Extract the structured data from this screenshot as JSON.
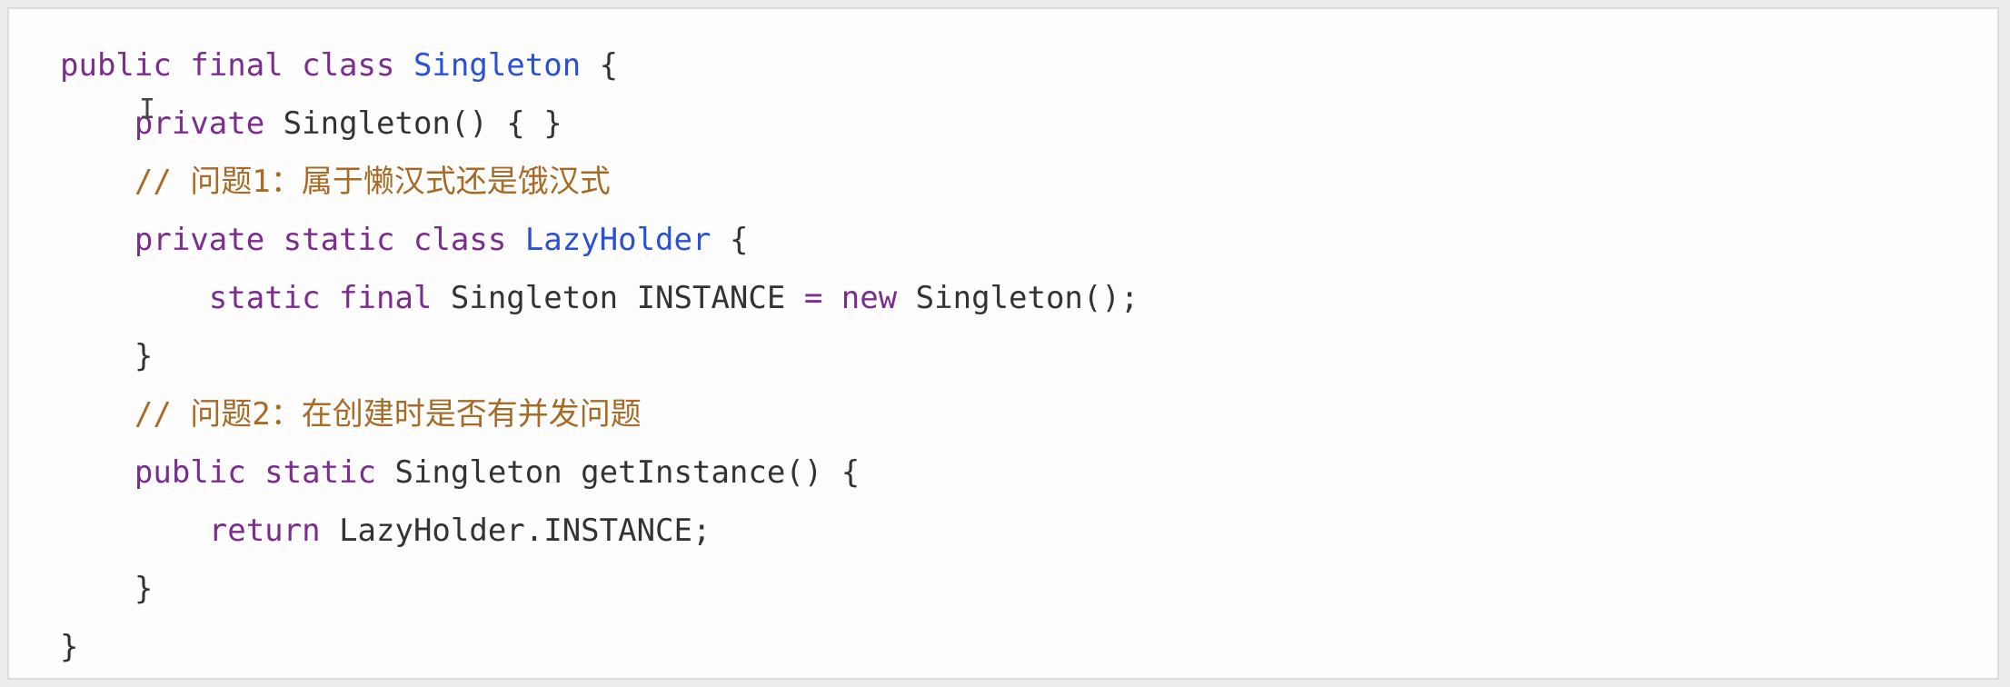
{
  "lines": [
    [
      {
        "t": "public final class ",
        "k": "kw"
      },
      {
        "t": "Singleton",
        "k": "cls"
      },
      {
        "t": " {",
        "k": "txt"
      }
    ],
    [
      {
        "t": "    ",
        "k": "txt"
      },
      {
        "t": "private",
        "k": "kw"
      },
      {
        "t": " Singleton() { }",
        "k": "txt"
      }
    ],
    [
      {
        "t": "    // 问题1：属于懒汉式还是饿汉式",
        "k": "cmt"
      }
    ],
    [
      {
        "t": "    ",
        "k": "txt"
      },
      {
        "t": "private static class ",
        "k": "kw"
      },
      {
        "t": "LazyHolder",
        "k": "cls"
      },
      {
        "t": " {",
        "k": "txt"
      }
    ],
    [
      {
        "t": "        ",
        "k": "txt"
      },
      {
        "t": "static final",
        "k": "kw"
      },
      {
        "t": " Singleton INSTANCE ",
        "k": "txt"
      },
      {
        "t": "=",
        "k": "kw"
      },
      {
        "t": " ",
        "k": "txt"
      },
      {
        "t": "new",
        "k": "kw"
      },
      {
        "t": " Singleton();",
        "k": "txt"
      }
    ],
    [
      {
        "t": "    }",
        "k": "txt"
      }
    ],
    [
      {
        "t": "    // 问题2：在创建时是否有并发问题",
        "k": "cmt"
      }
    ],
    [
      {
        "t": "    ",
        "k": "txt"
      },
      {
        "t": "public static",
        "k": "kw"
      },
      {
        "t": " Singleton getInstance() {",
        "k": "txt"
      }
    ],
    [
      {
        "t": "        ",
        "k": "txt"
      },
      {
        "t": "return",
        "k": "kw"
      },
      {
        "t": " LazyHolder.INSTANCE;",
        "k": "txt"
      }
    ],
    [
      {
        "t": "    }",
        "k": "txt"
      }
    ],
    [
      {
        "t": "}",
        "k": "txt"
      }
    ]
  ],
  "colors": {
    "keyword": "#7b2c8f",
    "class_name": "#2b4fd6",
    "comment": "#a86b25",
    "text": "#333333"
  },
  "cursor": {
    "glyph": "I"
  }
}
